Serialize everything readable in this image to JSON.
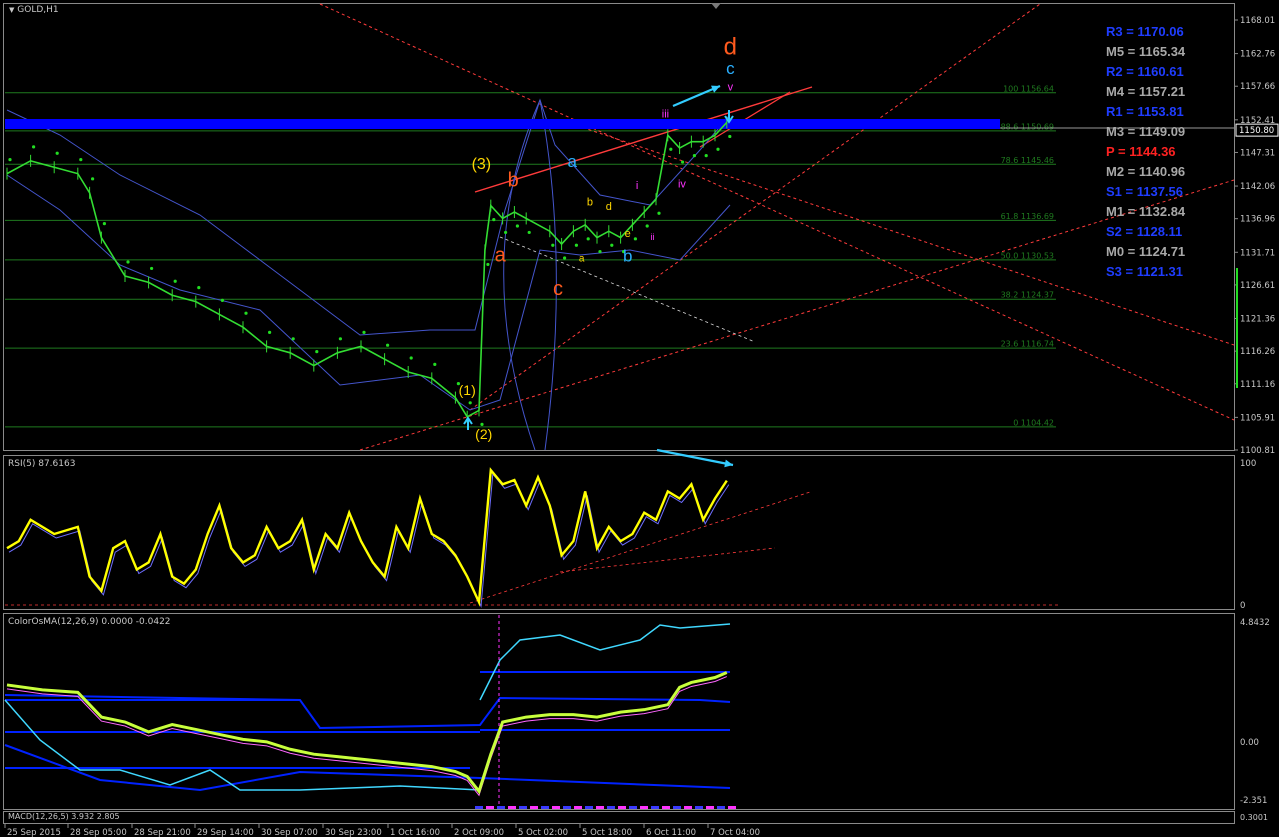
{
  "window": {
    "symbol_label": "GOLD,H1"
  },
  "colors": {
    "background": "#000000",
    "candle": "#33dd33",
    "sar": "#22dd22",
    "band": "#4455cc",
    "resistance_zone": "#0000ff",
    "fib": "#1f7a1f",
    "rsi_line": "#ffff00",
    "wave_orange": "#ff5a1e",
    "wave_cyan": "#2ab0ff",
    "wave_magenta": "#ff33ff",
    "wave_yellow": "#ffd700",
    "arrow": "#33ccff",
    "trend_red": "#ff3b3b"
  },
  "price_axis": {
    "ticks": [
      "1168.01",
      "1162.76",
      "1157.66",
      "1152.41",
      "1147.31",
      "1142.06",
      "1136.96",
      "1131.71",
      "1126.61",
      "1121.36",
      "1116.26",
      "1111.16",
      "1105.91",
      "1100.81"
    ],
    "current_price": "1150.80"
  },
  "fib_levels": [
    {
      "label": "100 1156.64",
      "value": 1156.64
    },
    {
      "label": "88.6 1150.69",
      "value": 1150.69
    },
    {
      "label": "78.6 1145.46",
      "value": 1145.46
    },
    {
      "label": "61.8 1136.69",
      "value": 1136.69
    },
    {
      "label": "50.0 1130.53",
      "value": 1130.53
    },
    {
      "label": "38.2 1124.37",
      "value": 1124.37
    },
    {
      "label": "23.6 1116.74",
      "value": 1116.74
    },
    {
      "label": "0 1104.42",
      "value": 1104.42
    }
  ],
  "pivots": [
    {
      "label": "R3 = 1170.06",
      "color": "#1f3dff"
    },
    {
      "label": "M5 = 1165.34",
      "color": "#a8a8a8"
    },
    {
      "label": "R2 = 1160.61",
      "color": "#1f3dff"
    },
    {
      "label": "M4 = 1157.21",
      "color": "#a8a8a8"
    },
    {
      "label": "R1 = 1153.81",
      "color": "#1f3dff"
    },
    {
      "label": "M3 = 1149.09",
      "color": "#a8a8a8"
    },
    {
      "label": "P   = 1144.36",
      "color": "#ff2222"
    },
    {
      "label": "M2 = 1140.96",
      "color": "#a8a8a8"
    },
    {
      "label": "S1 = 1137.56",
      "color": "#1f3dff"
    },
    {
      "label": "M1 = 1132.84",
      "color": "#a8a8a8"
    },
    {
      "label": "S2 = 1128.11",
      "color": "#1f3dff"
    },
    {
      "label": "M0 = 1124.71",
      "color": "#a8a8a8"
    },
    {
      "label": "S3 = 1121.31",
      "color": "#1f3dff"
    }
  ],
  "wave_labels": [
    {
      "text": "d",
      "color": "#ff5a1e",
      "t": 61.3,
      "p": 1162.6,
      "size": 24
    },
    {
      "text": "c",
      "color": "#2ab0ff",
      "t": 61.3,
      "p": 1159.6,
      "size": 17
    },
    {
      "text": "v",
      "color": "#ff33ff",
      "t": 61.3,
      "p": 1157.0,
      "size": 11
    },
    {
      "text": "iii",
      "color": "#ff33ff",
      "t": 55.8,
      "p": 1152.8,
      "size": 11
    },
    {
      "text": "iv",
      "color": "#ff33ff",
      "t": 57.2,
      "p": 1141.8,
      "size": 11
    },
    {
      "text": "i",
      "color": "#ff33ff",
      "t": 53.4,
      "p": 1141.6,
      "size": 11
    },
    {
      "text": "ii",
      "color": "#ff33ff",
      "t": 54.7,
      "p": 1133.6,
      "size": 9
    },
    {
      "text": "(3)",
      "color": "#ffd700",
      "t": 40.2,
      "p": 1144.7,
      "size": 16
    },
    {
      "text": "b",
      "color": "#ff5a1e",
      "t": 42.9,
      "p": 1142.0,
      "size": 20
    },
    {
      "text": "a",
      "color": "#2ab0ff",
      "t": 47.9,
      "p": 1145.0,
      "size": 17
    },
    {
      "text": "b",
      "color": "#ffd700",
      "t": 49.4,
      "p": 1139.0,
      "size": 11
    },
    {
      "text": "d",
      "color": "#ffd700",
      "t": 51.0,
      "p": 1138.3,
      "size": 11
    },
    {
      "text": "e",
      "color": "#ffd700",
      "t": 52.6,
      "p": 1134.1,
      "size": 11
    },
    {
      "text": "a",
      "color": "#ff5a1e",
      "t": 41.8,
      "p": 1130.3,
      "size": 20
    },
    {
      "text": "b",
      "color": "#2ab0ff",
      "t": 52.6,
      "p": 1130.3,
      "size": 17
    },
    {
      "text": "a",
      "color": "#ffd700",
      "t": 48.7,
      "p": 1130.3,
      "size": 10
    },
    {
      "text": "c",
      "color": "#ff5a1e",
      "t": 46.7,
      "p": 1125.0,
      "size": 20
    },
    {
      "text": "(1)",
      "color": "#ffd700",
      "t": 39.0,
      "p": 1109.4,
      "size": 14
    },
    {
      "text": "(2)",
      "color": "#ffd700",
      "t": 40.4,
      "p": 1102.5,
      "size": 14
    }
  ],
  "time_axis": [
    "25 Sep 2015",
    "28 Sep 05:00",
    "28 Sep 21:00",
    "29 Sep 14:00",
    "30 Sep 07:00",
    "30 Sep 23:00",
    "1 Oct 16:00",
    "2 Oct 09:00",
    "5 Oct 02:00",
    "5 Oct 18:00",
    "6 Oct 11:00",
    "7 Oct 04:00"
  ],
  "chart_data": [
    {
      "type": "line",
      "pane": "main",
      "indicator": "GOLD,H1",
      "x": [
        0,
        2,
        4,
        6,
        7,
        8,
        10,
        12,
        14,
        16,
        18,
        20,
        22,
        24,
        26,
        28,
        30,
        32,
        34,
        36,
        38,
        39,
        40,
        40.5,
        41,
        42,
        43,
        44,
        46,
        47,
        48,
        49,
        50,
        51,
        52,
        53,
        54,
        55,
        56,
        57,
        58,
        59,
        60,
        61
      ],
      "values": [
        1144,
        1146,
        1145,
        1144,
        1141,
        1134,
        1128,
        1127,
        1125,
        1124,
        1122,
        1120,
        1117,
        1116,
        1114,
        1116,
        1117,
        1115,
        1113,
        1112,
        1109,
        1106,
        1107,
        1132,
        1139,
        1137,
        1138,
        1137,
        1135,
        1133,
        1135,
        1136,
        1134,
        1135,
        1134,
        1136,
        1138,
        1140,
        1150,
        1148,
        1149,
        1149,
        1150,
        1152
      ],
      "ylim": [
        1100.81,
        1168.01
      ]
    },
    {
      "type": "line",
      "pane": "rsi",
      "indicator": "RSI(5) 87.6163",
      "x": [
        0,
        1,
        2,
        3,
        4,
        6,
        7,
        8,
        9,
        10,
        11,
        12,
        13,
        14,
        15,
        16,
        17,
        18,
        19,
        20,
        21,
        22,
        23,
        24,
        25,
        26,
        27,
        28,
        29,
        30,
        31,
        32,
        33,
        34,
        35,
        36,
        37,
        38,
        39,
        40,
        41,
        42,
        43,
        44,
        45,
        46,
        47,
        48,
        49,
        50,
        51,
        52,
        53,
        54,
        55,
        56,
        57,
        58,
        59,
        60,
        61
      ],
      "values": [
        40,
        45,
        60,
        55,
        50,
        55,
        20,
        10,
        40,
        45,
        25,
        30,
        50,
        20,
        15,
        25,
        50,
        70,
        40,
        30,
        35,
        55,
        40,
        45,
        60,
        25,
        50,
        40,
        65,
        45,
        30,
        20,
        55,
        40,
        75,
        50,
        45,
        35,
        20,
        2,
        95,
        85,
        88,
        70,
        90,
        70,
        35,
        45,
        80,
        40,
        55,
        45,
        50,
        65,
        60,
        80,
        75,
        85,
        60,
        75,
        87.6
      ],
      "ylim": [
        0,
        100
      ]
    },
    {
      "type": "line",
      "pane": "macd",
      "indicator": "ColorOsMA(12,26,9) 0.0000 -0.0422",
      "x": [
        0,
        3,
        6,
        7,
        8,
        10,
        12,
        14,
        16,
        18,
        20,
        22,
        24,
        26,
        28,
        30,
        32,
        34,
        36,
        38,
        39,
        40,
        41,
        42,
        44,
        46,
        48,
        50,
        52,
        54,
        55,
        56,
        57,
        58,
        59,
        60,
        61
      ],
      "values": [
        2.3,
        2.1,
        2.0,
        1.5,
        1.0,
        0.8,
        0.4,
        0.7,
        0.5,
        0.3,
        0.1,
        0.0,
        -0.3,
        -0.5,
        -0.6,
        -0.7,
        -0.8,
        -0.9,
        -1.0,
        -1.2,
        -1.4,
        -2.0,
        -0.5,
        0.8,
        1.0,
        1.1,
        1.1,
        1.0,
        1.2,
        1.3,
        1.4,
        1.5,
        2.2,
        2.4,
        2.5,
        2.6,
        2.8
      ],
      "ylim": [
        -2.351,
        4.8432
      ]
    }
  ],
  "indicators": {
    "rsi_label": "RSI(5) 87.6163",
    "rsi_ticks": [
      "100",
      "0"
    ],
    "macd_label": "ColorOsMA(12,26,9) 0.0000 -0.0422",
    "macd_ticks": [
      "4.8432",
      "0.00",
      "-2.351"
    ],
    "macd_sub_label": "MACD(12,26,5) 3.932 2.805",
    "macd_sub_tick": "0.3001"
  }
}
